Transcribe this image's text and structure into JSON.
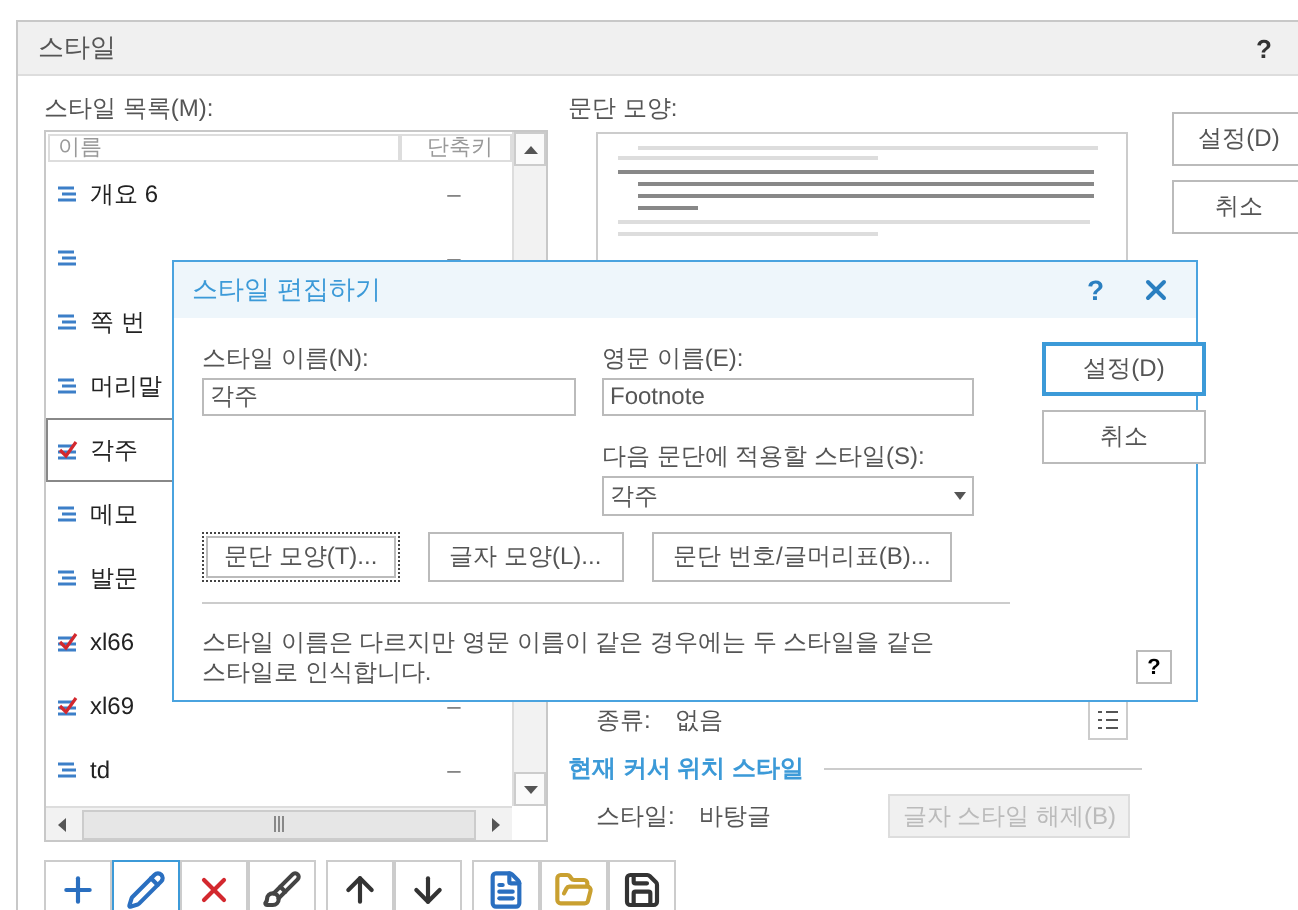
{
  "window": {
    "title": "스타일",
    "help": "?"
  },
  "style_list": {
    "label": "스타일 목록(M):",
    "columns": [
      "이름",
      "단축키"
    ],
    "rows": [
      {
        "name": "개요 6",
        "shortcut": "–",
        "kind": "paragraph",
        "selected": false
      },
      {
        "shortcut": "–",
        "kind": "paragraph",
        "selected": false
      },
      {
        "name": "쪽 번",
        "kind": "paragraph",
        "selected": false
      },
      {
        "name": "머리말",
        "kind": "paragraph",
        "selected": false
      },
      {
        "name": "각주",
        "kind": "character",
        "selected": true
      },
      {
        "name": "메모",
        "kind": "paragraph",
        "selected": false
      },
      {
        "name": "발문",
        "kind": "paragraph",
        "selected": false
      },
      {
        "name": "xl66",
        "kind": "character",
        "selected": false
      },
      {
        "name": "xl69",
        "shortcut": "–",
        "kind": "character",
        "selected": false
      },
      {
        "name": "td",
        "shortcut": "–",
        "kind": "paragraph",
        "selected": false
      }
    ]
  },
  "preview": {
    "label": "문단 모양:"
  },
  "numbering": {
    "label": "종류:",
    "value": "없음"
  },
  "current_style": {
    "heading": "현재 커서 위치 스타일",
    "label": "스타일:",
    "value": "바탕글",
    "button": {
      "label": "글자 스타일 해제(B)",
      "disabled": true
    }
  },
  "buttons": [
    {
      "label": "설정(D)"
    },
    {
      "label": "취소"
    }
  ],
  "toolbar": [
    {
      "kind": "add",
      "selected": false
    },
    {
      "kind": "edit",
      "selected": true
    },
    {
      "kind": "delete",
      "selected": false
    },
    {
      "kind": "format",
      "selected": false
    },
    {
      "kind": "up",
      "selected": false
    },
    {
      "kind": "down",
      "selected": false
    },
    {
      "kind": "import",
      "selected": false
    },
    {
      "kind": "open",
      "selected": false
    },
    {
      "kind": "save",
      "selected": false
    }
  ],
  "edit_dialog": {
    "title": "스타일 편집하기",
    "help": "?",
    "name_label": "스타일 이름(N):",
    "name_value": "각주",
    "english_label": "영문 이름(E):",
    "english_value": "Footnote",
    "next_label": "다음 문단에 적용할 스타일(S):",
    "next_value": "각주",
    "buttons": [
      {
        "label": "문단 모양(T)...",
        "focused": true
      },
      {
        "label": "글자 모양(L)...",
        "focused": false
      },
      {
        "label": "문단 번호/글머리표(B)...",
        "focused": false
      }
    ],
    "note": "스타일 이름은 다르지만 영문 이름이 같은 경우에는 두 스타일을 같은 스타일로 인식합니다.",
    "side_buttons": [
      {
        "label": "설정(D)",
        "default": true
      },
      {
        "label": "취소",
        "default": false
      }
    ],
    "help_button": "?"
  }
}
